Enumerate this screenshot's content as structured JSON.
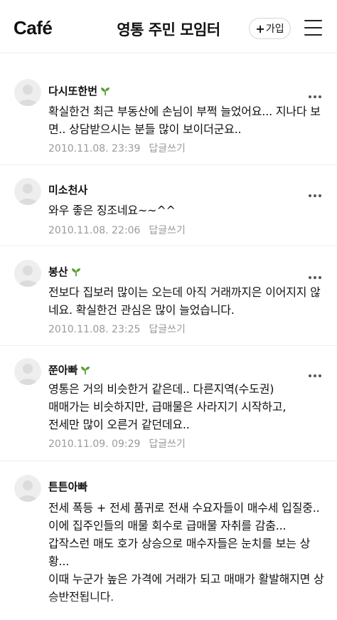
{
  "header": {
    "logo": "Café",
    "title": "영통 주민 모임터",
    "join_label": "가입",
    "join_plus": "+"
  },
  "comments": [
    {
      "nickname": "다시또한번",
      "has_sprout": true,
      "text": "확실한건 최근 부동산에 손님이 부쩍 늘었어요... 지나다 보면.. 상담받으시는 분들 많이 보이더군요..",
      "date": "2010.11.08. 23:39",
      "reply": "답글쓰기"
    },
    {
      "nickname": "미소천사",
      "has_sprout": false,
      "text": "와우 좋은 징조네요~~^^",
      "date": "2010.11.08. 22:06",
      "reply": "답글쓰기"
    },
    {
      "nickname": "봉산",
      "has_sprout": true,
      "text": "전보다 집보러 많이는 오는데 아직 거래까지은 이어지지 않네요. 확실한건 관심은 많이 늘었습니다.",
      "date": "2010.11.08. 23:25",
      "reply": "답글쓰기"
    },
    {
      "nickname": "쭌아빠",
      "has_sprout": true,
      "text": "영통은 거의 비슷한거 같은데.. 다른지역(수도권)\n매매가는 비슷하지만, 급매물은 사라지기 시작하고,\n전세만 많이 오른거 같던데요..",
      "date": "2010.11.09. 09:29",
      "reply": "답글쓰기"
    },
    {
      "nickname": "튼튼아빠",
      "has_sprout": false,
      "text": "전세 폭등 + 전세 품귀로 전새 수요자들이 매수세 입질중.. 이에 집주인들의 매물 회수로 급매물 자취를 감춤...\n갑작스런 매도 호가 상승으로 매수자들은 눈치를 보는 상황...\n이때 누군가 높은 가격에 거래가 되고 매매가 활발해지면 상승반전됩니다.",
      "date": "",
      "reply": ""
    }
  ]
}
